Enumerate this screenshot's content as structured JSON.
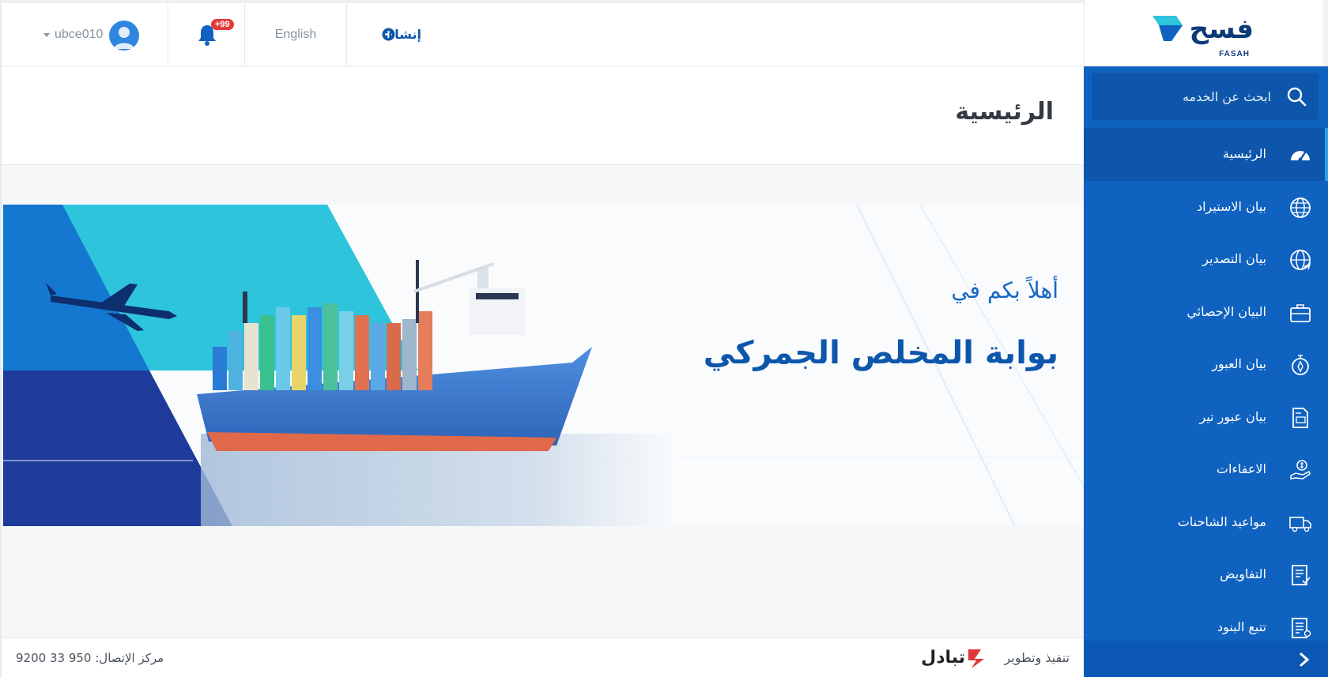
{
  "sidebar": {
    "brand": {
      "name_ar": "فسح",
      "name_en": "FASAH"
    },
    "search": {
      "placeholder": "ابحث عن الخدمه"
    },
    "items": [
      {
        "label": "الرئيسية",
        "icon": "dashboard-gauge-icon",
        "active": true
      },
      {
        "label": "بيان الاستيراد",
        "icon": "globe-import-icon"
      },
      {
        "label": "بيان التصدير",
        "icon": "globe-export-icon"
      },
      {
        "label": "البيان الإحصائي",
        "icon": "briefcase-icon"
      },
      {
        "label": "بيان العبور",
        "icon": "compass-icon"
      },
      {
        "label": "بيان عبور تير",
        "icon": "tir-document-icon"
      },
      {
        "label": "الاعفاءات",
        "icon": "hand-dollar-icon"
      },
      {
        "label": "مواعيد الشاحنات",
        "icon": "truck-icon"
      },
      {
        "label": "التفاويض",
        "icon": "authorization-document-icon"
      },
      {
        "label": "تتبع البنود",
        "icon": "track-items-icon"
      }
    ],
    "accent": "#1062c0"
  },
  "topbar": {
    "create_label": "إنشاء",
    "language_label": "English",
    "notifications_badge": "+99",
    "username": "ubce010"
  },
  "page": {
    "title": "الرئيسية"
  },
  "banner": {
    "welcome": "أهلاً بكم في",
    "portal_title": "بوابة المخلص الجمركي"
  },
  "footer": {
    "contact": "مركز الإتصال: 950 33 9200",
    "developed_by": "تنفيذ وتطوير",
    "developer_name": "تبادل"
  }
}
